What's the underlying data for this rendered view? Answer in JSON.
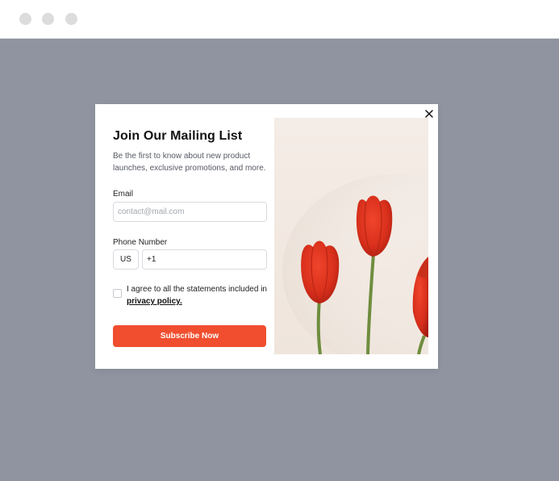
{
  "modal": {
    "title": "Join Our Mailing List",
    "subtitle": "Be the first to know about new product launches, exclusive promotions, and more.",
    "close_icon": "close-icon",
    "email": {
      "label": "Email",
      "placeholder": "contact@mail.com",
      "value": ""
    },
    "phone": {
      "label": "Phone Number",
      "country": "US",
      "value": "+1"
    },
    "consent": {
      "text": "I agree to all the statements included in",
      "link": "privacy policy.",
      "checked": false
    },
    "subscribe_label": "Subscribe Now",
    "image": "red-tulips-photo"
  },
  "colors": {
    "accent": "#f04e2f",
    "overlay": "#9094a0",
    "window_dot": "#dcdcdc"
  }
}
